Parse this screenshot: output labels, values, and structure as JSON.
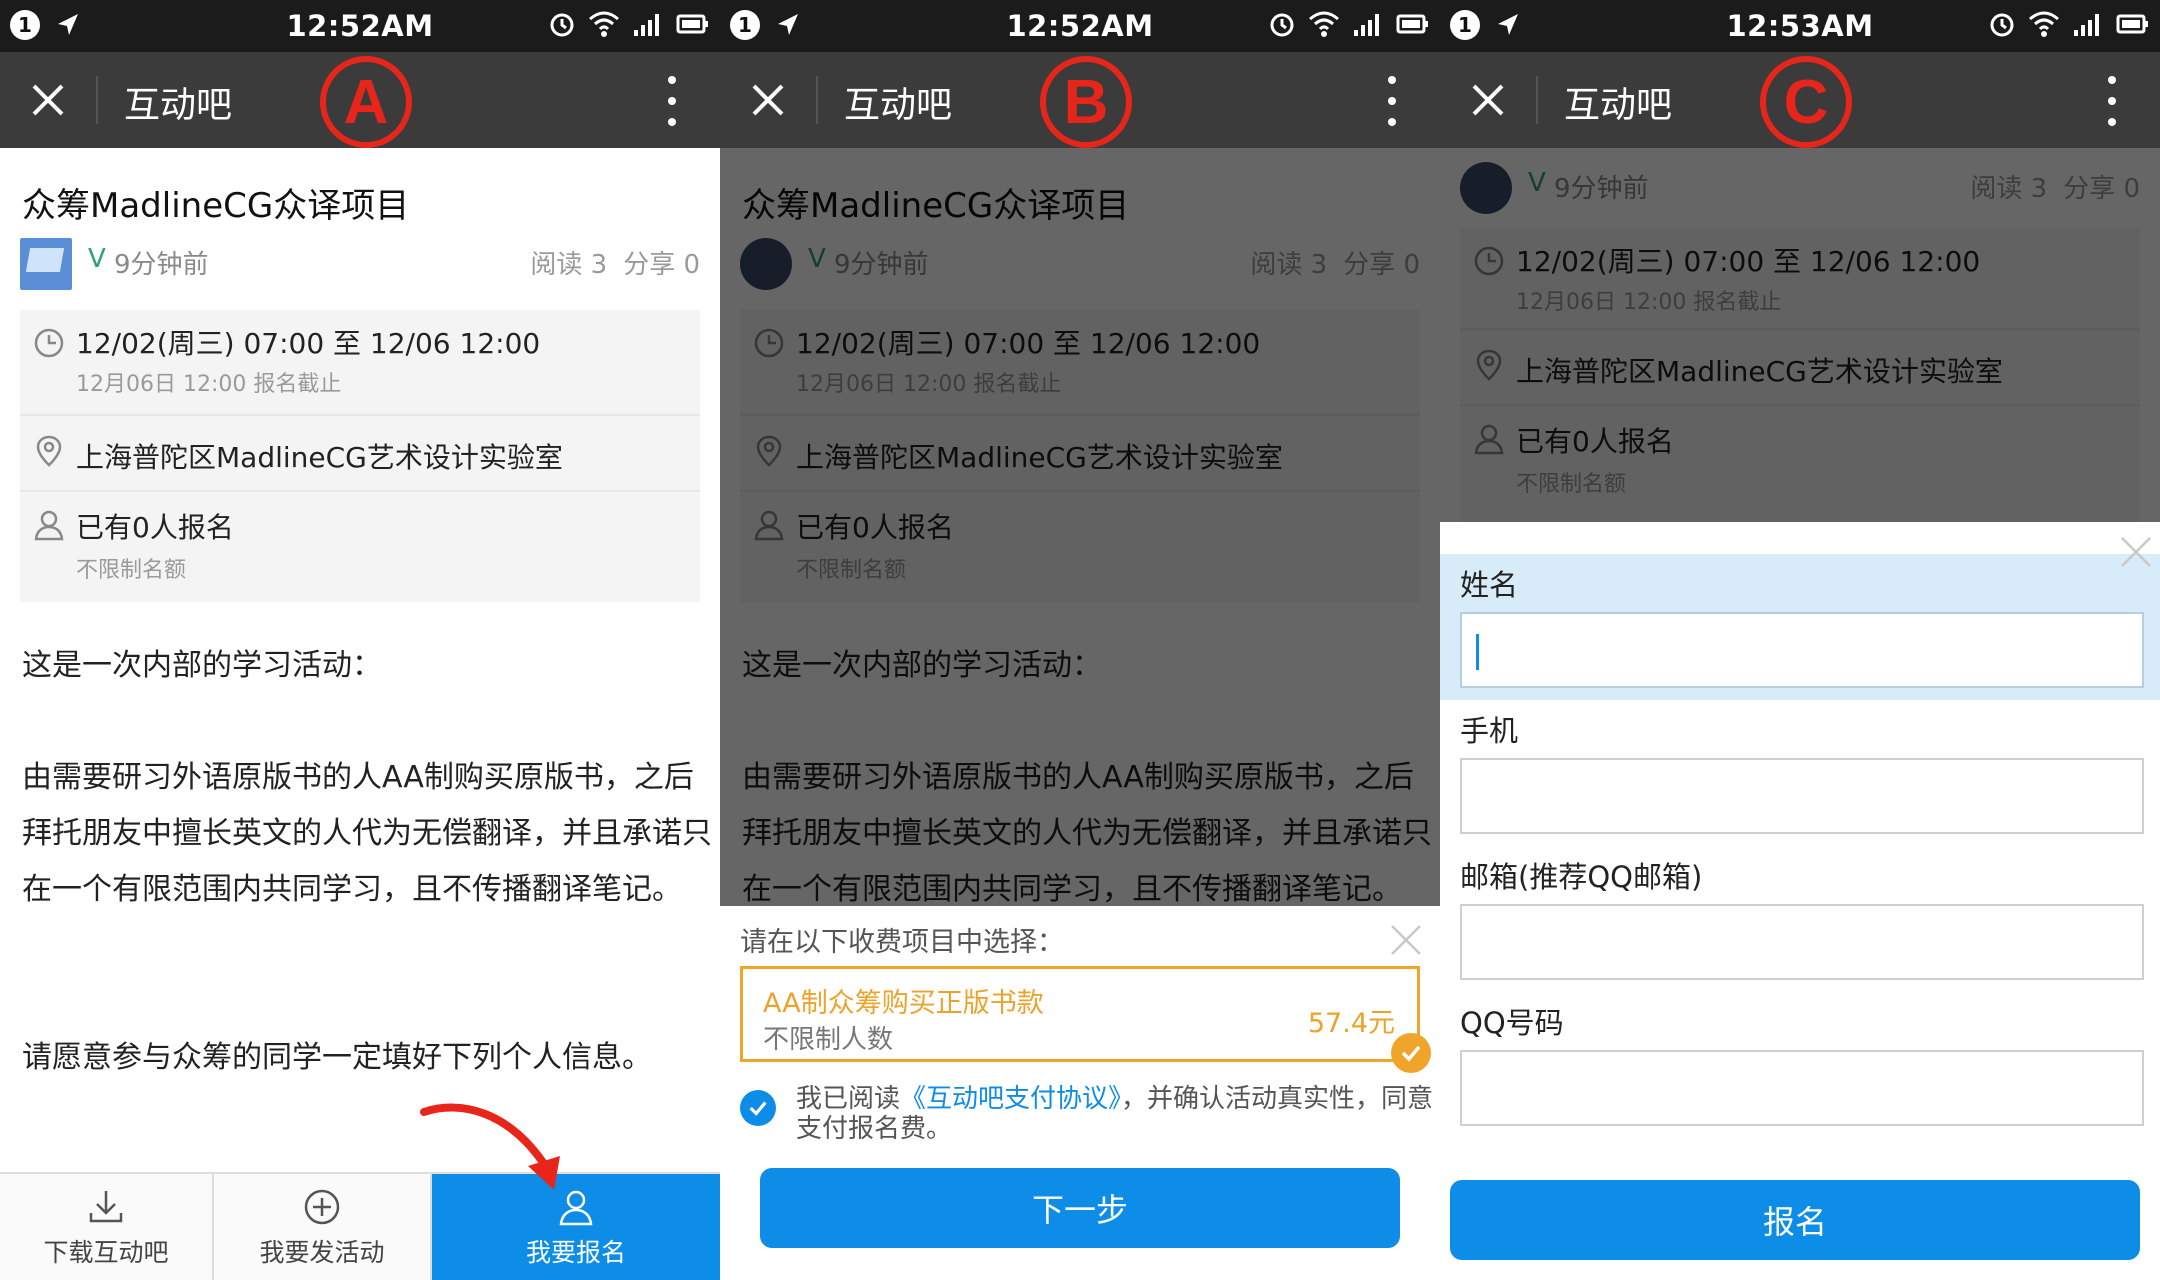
{
  "status": {
    "notif_count": "1",
    "times": [
      "12:52AM",
      "12:52AM",
      "12:53AM"
    ]
  },
  "nav": {
    "title": "互动吧",
    "labels": [
      "A",
      "B",
      "C"
    ]
  },
  "event": {
    "title": "众筹MadlineCG众译项目",
    "verified": "V",
    "posted_ago": "9分钟前",
    "read": "阅读 3",
    "share": "分享 0",
    "time_range": "12/02(周三) 07:00 至 12/06 12:00",
    "deadline": "12月06日 12:00 报名截止",
    "location": "上海普陀区MadlineCG艺术设计实验室",
    "signup_count": "已有0人报名",
    "quota": "不限制名额",
    "para1": "这是一次内部的学习活动：",
    "para2": "由需要研习外语原版书的人AA制购买原版书，之后拜托朋友中擅长英文的人代为无偿翻译，并且承诺只在一个有限范围内共同学习，且不传播翻译笔记。",
    "para3": "请愿意参与众筹的同学一定填好下列个人信息。"
  },
  "bottombar": {
    "download": "下载互动吧",
    "publish": "我要发活动",
    "signup": "我要报名"
  },
  "fee_sheet": {
    "prompt": "请在以下收费项目中选择：",
    "fee_name": "AA制众筹购买正版书款",
    "fee_limit": "不限制人数",
    "fee_price": "57.4元",
    "agree_prefix": "我已阅读",
    "agree_link": "《互动吧支付协议》",
    "agree_suffix": "，并确认活动真实性，同意支付报名费。",
    "next_button": "下一步"
  },
  "form": {
    "name_label": "姓名",
    "phone_label": "手机",
    "email_label": "邮箱(推荐QQ邮箱)",
    "qq_label": "QQ号码",
    "submit_button": "报名"
  },
  "colors": {
    "primary_blue": "#0d8de8",
    "fee_orange": "#f0a52a",
    "label_red": "#e8251a",
    "navbar": "#3b3b3b"
  }
}
